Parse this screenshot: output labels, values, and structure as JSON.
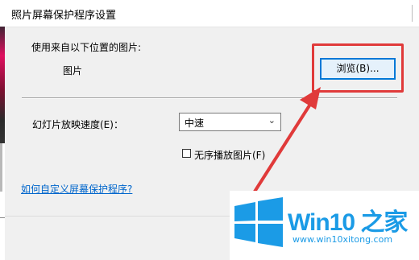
{
  "window": {
    "title": "照片屏幕保护程序设置"
  },
  "source": {
    "label": "使用来自以下位置的图片:",
    "folder_value": "图片",
    "browse_label": "浏览(B)..."
  },
  "speed": {
    "label": "幻灯片放映速度(E)：",
    "selected": "中速"
  },
  "shuffle": {
    "label": "无序播放图片(F)",
    "checked": false
  },
  "help_link": "如何自定义屏幕保护程序?",
  "watermark": {
    "brand_prefix": "Win10",
    "brand_suffix": "之家",
    "url": "www.win10xitong.com"
  },
  "colors": {
    "accent": "#0078d7",
    "annotation": "#e03a3a",
    "brand": "#1b9be6"
  }
}
